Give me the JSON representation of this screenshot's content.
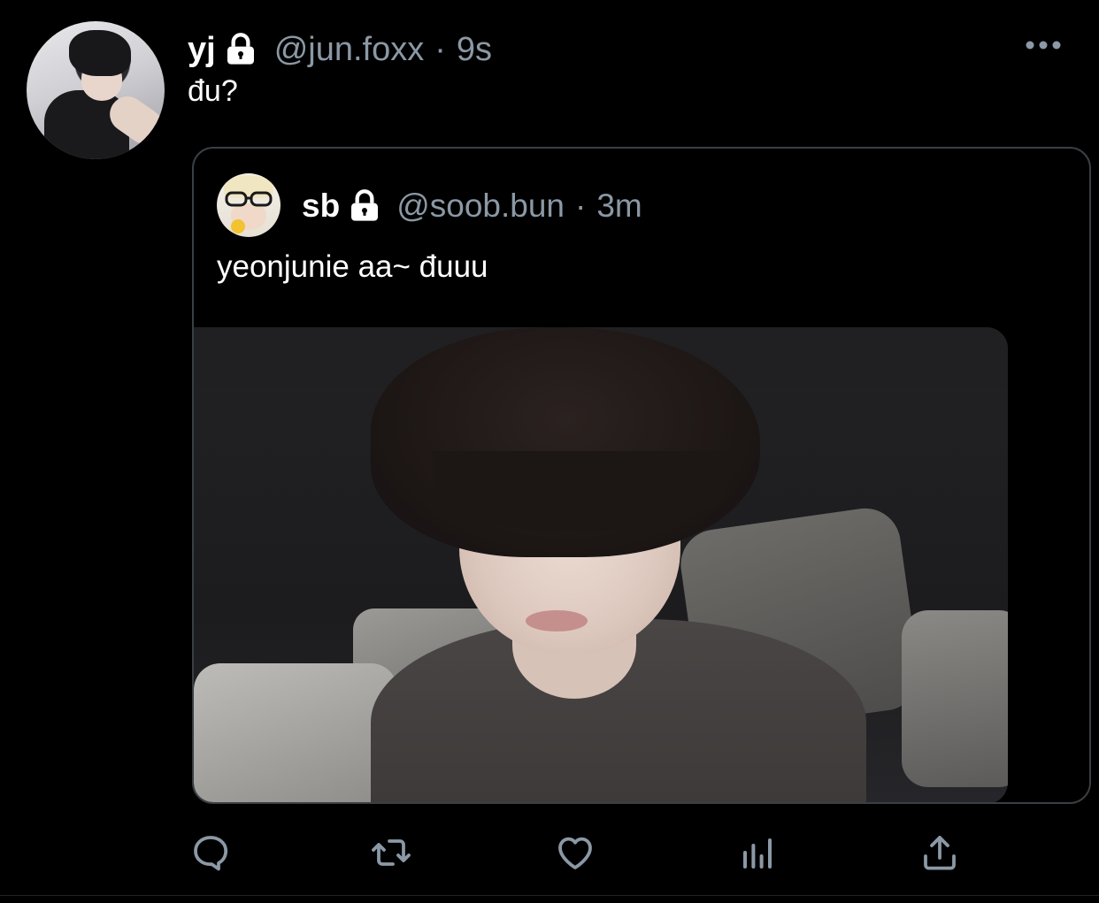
{
  "tweet": {
    "display_name": "yj",
    "handle": "@jun.foxx",
    "separator": "·",
    "timestamp": "9s",
    "text": "đu?",
    "avatar_icon": "profile-photo"
  },
  "quoted_tweet": {
    "display_name": "sb",
    "handle": "@soob.bun",
    "separator": "·",
    "timestamp": "3m",
    "text": "yeonjunie aa~ đuuu",
    "media_icon": "photo"
  },
  "actions": {
    "reply_icon": "reply-icon",
    "retweet_icon": "retweet-icon",
    "like_icon": "heart-icon",
    "analytics_icon": "analytics-icon",
    "share_icon": "share-icon"
  },
  "colors": {
    "background": "#000000",
    "text_primary": "#ffffff",
    "text_secondary": "#8b98a5",
    "border": "#3a3f44",
    "icon": "#8b98a5"
  }
}
